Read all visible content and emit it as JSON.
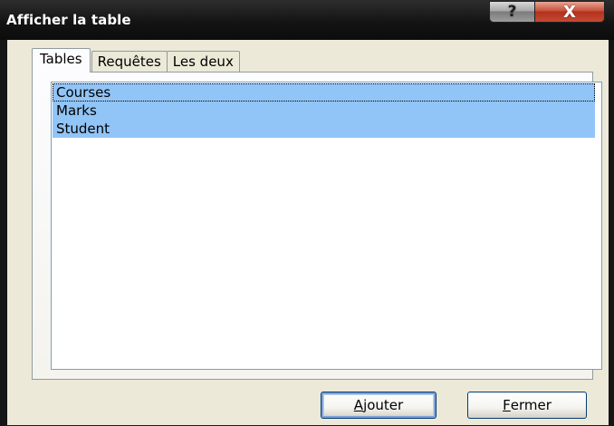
{
  "window": {
    "title": "Afficher la table",
    "help_glyph": "?",
    "close_glyph": "X"
  },
  "tabs": [
    {
      "label": "Tables",
      "active": true
    },
    {
      "label": "Requêtes",
      "active": false
    },
    {
      "label": "Les deux",
      "active": false
    }
  ],
  "list": {
    "items": [
      {
        "label": "Courses",
        "selected": true,
        "focused": true
      },
      {
        "label": "Marks",
        "selected": true,
        "focused": false
      },
      {
        "label": "Student",
        "selected": true,
        "focused": false
      }
    ]
  },
  "buttons": {
    "add": {
      "mnemonic": "A",
      "rest": "jouter"
    },
    "close": {
      "mnemonic": "F",
      "rest": "ermer"
    }
  },
  "colors": {
    "selection": "#91c4f7",
    "titlebar": "#141414",
    "close_button": "#c44b34"
  }
}
